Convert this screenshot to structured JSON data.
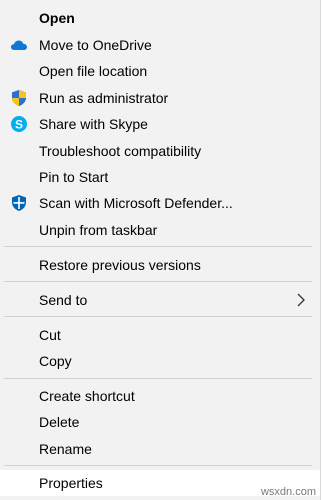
{
  "menu": {
    "items": [
      {
        "label": "Open"
      },
      {
        "label": "Move to OneDrive",
        "icon": "onedrive-cloud-icon"
      },
      {
        "label": "Open file location"
      },
      {
        "label": "Run as administrator",
        "icon": "uac-shield-icon"
      },
      {
        "label": "Share with Skype",
        "icon": "skype-icon"
      },
      {
        "label": "Troubleshoot compatibility"
      },
      {
        "label": "Pin to Start"
      },
      {
        "label": "Scan with Microsoft Defender...",
        "icon": "defender-shield-icon"
      },
      {
        "label": "Unpin from taskbar"
      },
      {
        "label": "Restore previous versions"
      },
      {
        "label": "Send to",
        "icon": "chevron-right-icon"
      },
      {
        "label": "Cut"
      },
      {
        "label": "Copy"
      },
      {
        "label": "Create shortcut"
      },
      {
        "label": "Delete"
      },
      {
        "label": "Rename"
      },
      {
        "label": "Properties"
      }
    ]
  },
  "watermark": "wsxdn.com",
  "colors": {
    "menu_bg": "#f2f2f2",
    "hover_bg": "#ffffff",
    "separator": "#d0d0d0",
    "onedrive_blue": "#0f78d4",
    "skype_blue": "#00aff0",
    "defender_blue": "#0067b8",
    "uac_yellow": "#f5c518"
  }
}
